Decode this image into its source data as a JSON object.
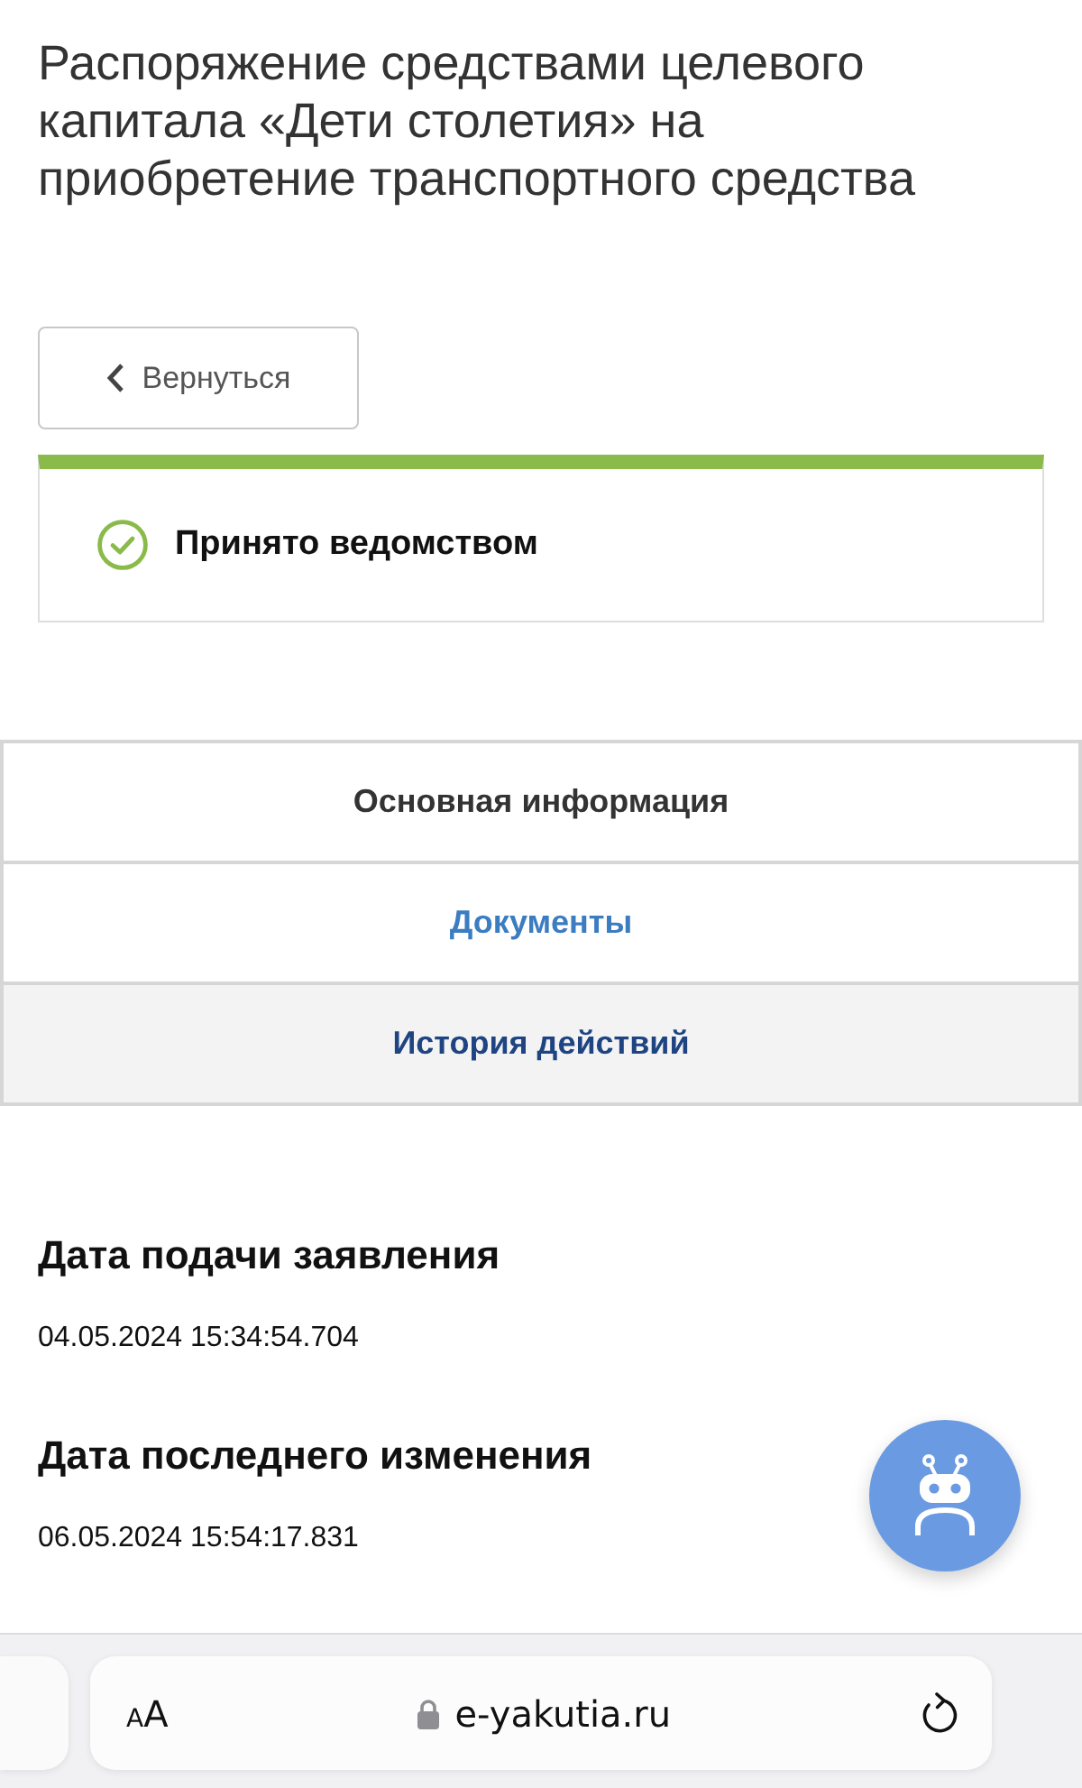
{
  "title": "Распоряжение средствами целевого капитала «Дети столетия» на приобретение транспортного средства",
  "back_button": {
    "label": "Вернуться"
  },
  "status": {
    "label": "Принято ведомством",
    "kind": "success"
  },
  "tabs": [
    {
      "label": "Основная информация",
      "selected": true,
      "pressed": false
    },
    {
      "label": "Документы",
      "selected": false,
      "pressed": false
    },
    {
      "label": "История действий",
      "selected": false,
      "pressed": true
    }
  ],
  "fields": [
    {
      "label": "Дата подачи заявления",
      "value": "04.05.2024 15:34:54.704"
    },
    {
      "label": "Дата последнего изменения",
      "value": "06.05.2024 15:54:17.831"
    }
  ],
  "browser_bar": {
    "text_size": "AA",
    "url": "e-yakutia.ru"
  }
}
